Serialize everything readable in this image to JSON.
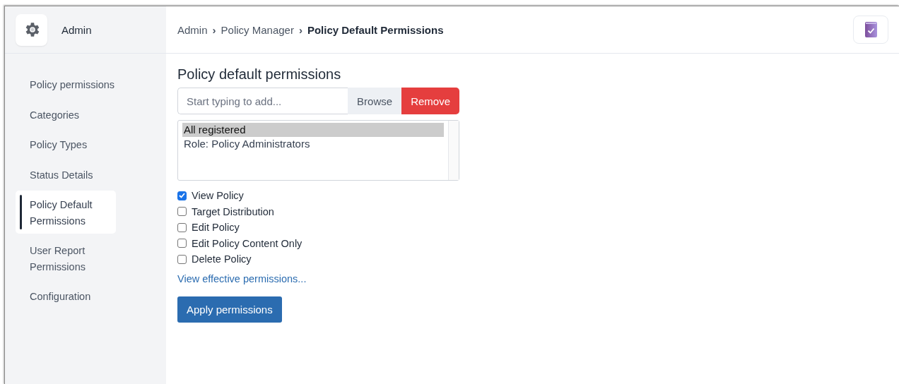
{
  "sidebar": {
    "title": "Admin",
    "items": [
      {
        "label": "Policy permissions",
        "selected": false
      },
      {
        "label": "Categories",
        "selected": false
      },
      {
        "label": "Policy Types",
        "selected": false
      },
      {
        "label": "Status Details",
        "selected": false
      },
      {
        "label": "Policy Default Permissions",
        "selected": true
      },
      {
        "label": "User Report Permissions",
        "selected": false
      },
      {
        "label": "Configuration",
        "selected": false
      }
    ]
  },
  "breadcrumb": [
    {
      "label": "Admin",
      "current": false
    },
    {
      "label": "Policy Manager",
      "current": false
    },
    {
      "label": "Policy Default Permissions",
      "current": true
    }
  ],
  "breadcrumb_separator": "›",
  "heading": "Policy default permissions",
  "search": {
    "placeholder": "Start typing to add...",
    "buttons": [
      {
        "label": "Browse",
        "kind": "secondary"
      },
      {
        "label": "Remove",
        "kind": "danger"
      }
    ]
  },
  "principals": [
    {
      "label": "All registered",
      "selected": true
    },
    {
      "label": "Role: Policy Administrators",
      "selected": false
    }
  ],
  "permissions": [
    {
      "label": "View Policy",
      "checked": true
    },
    {
      "label": "Target Distribution",
      "checked": false
    },
    {
      "label": "Edit Policy",
      "checked": false
    },
    {
      "label": "Edit Policy Content Only",
      "checked": false
    },
    {
      "label": "Delete Policy",
      "checked": false
    }
  ],
  "effective_link": "View effective permissions...",
  "apply_button": "Apply permissions"
}
